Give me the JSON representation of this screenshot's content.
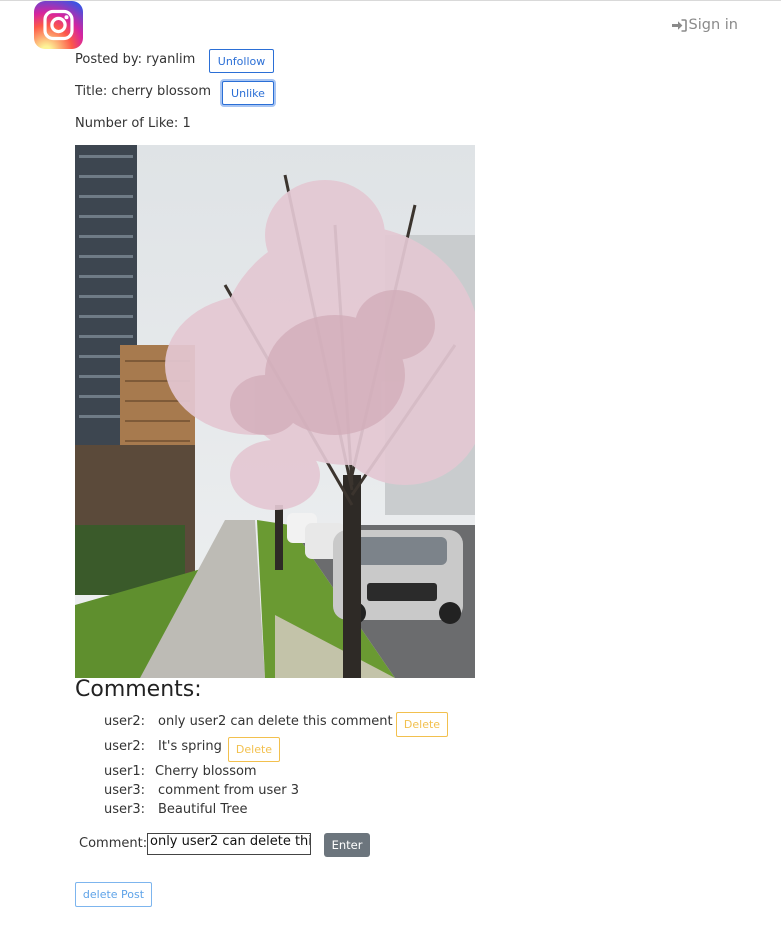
{
  "nav": {
    "logo": "Instagram",
    "signin_label": "Sign in",
    "signin_icon": "sign-in-icon"
  },
  "post": {
    "posted_by_label": "Posted by:",
    "posted_by_user": "ryanlim",
    "unfollow_label": "Unfollow",
    "title_label": "Title:",
    "title_value": "cherry blossom",
    "unlike_label": "Unlike",
    "likes_label": "Number of Like:",
    "likes_value": "1",
    "photo_alt": "cherry blossom"
  },
  "comments": {
    "heading": "Comments:",
    "items": [
      {
        "user": "user2:",
        "text": "only user2 can delete this comment",
        "delete_label": "Delete"
      },
      {
        "user": "user2:",
        "text": "It's spring",
        "delete_label": "Delete"
      },
      {
        "user": "user1:",
        "text": "Cherry blossom"
      },
      {
        "user": "user3:",
        "text": "comment from user 3"
      },
      {
        "user": "user3:",
        "text": "Beautiful Tree"
      }
    ]
  },
  "comment_form": {
    "label": "Comment:",
    "value": "only user2 can delete thi",
    "enter_label": "Enter"
  },
  "delete_post_label": "delete Post",
  "colors": {
    "primary": "#2b6fd6",
    "warning": "#f2c04e",
    "secondary": "#6c757d"
  }
}
